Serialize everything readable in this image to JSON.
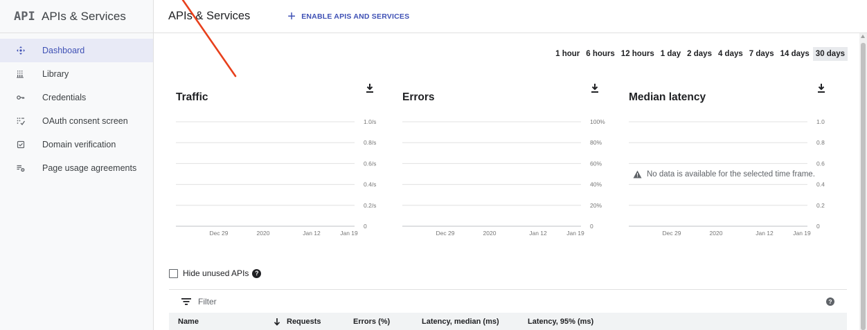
{
  "sidebar": {
    "logo": "API",
    "title": "APIs & Services",
    "items": [
      {
        "label": "Dashboard",
        "icon": "dashboard-icon",
        "active": true
      },
      {
        "label": "Library",
        "icon": "library-icon",
        "active": false
      },
      {
        "label": "Credentials",
        "icon": "key-icon",
        "active": false
      },
      {
        "label": "OAuth consent screen",
        "icon": "consent-icon",
        "active": false
      },
      {
        "label": "Domain verification",
        "icon": "checkbox-icon",
        "active": false
      },
      {
        "label": "Page usage agreements",
        "icon": "settings-list-icon",
        "active": false
      }
    ]
  },
  "header": {
    "title": "APIs & Services",
    "enable_label": "ENABLE APIS AND SERVICES"
  },
  "time_range": {
    "options": [
      "1 hour",
      "6 hours",
      "12 hours",
      "1 day",
      "2 days",
      "4 days",
      "7 days",
      "14 days",
      "30 days"
    ],
    "selected": "30 days"
  },
  "chart_data": [
    {
      "type": "line",
      "title": "Traffic",
      "x_ticks": [
        "Dec 29",
        "2020",
        "Jan 12",
        "Jan 19"
      ],
      "y_ticks": [
        "1.0/s",
        "0.8/s",
        "0.6/s",
        "0.4/s",
        "0.2/s",
        "0"
      ],
      "series": []
    },
    {
      "type": "line",
      "title": "Errors",
      "x_ticks": [
        "Dec 29",
        "2020",
        "Jan 12",
        "Jan 19"
      ],
      "y_ticks": [
        "100%",
        "80%",
        "60%",
        "40%",
        "20%",
        "0"
      ],
      "series": []
    },
    {
      "type": "line",
      "title": "Median latency",
      "x_ticks": [
        "Dec 29",
        "2020",
        "Jan 12",
        "Jan 19"
      ],
      "y_ticks": [
        "1.0",
        "0.8",
        "0.6",
        "0.4",
        "0.2",
        "0"
      ],
      "series": [],
      "no_data_message": "No data is available for the selected time frame."
    }
  ],
  "hide_unused": {
    "label": "Hide unused APIs",
    "checked": false
  },
  "filter": {
    "placeholder": "Filter"
  },
  "table": {
    "columns": [
      "Name",
      "Requests",
      "Errors (%)",
      "Latency, median (ms)",
      "Latency, 95% (ms)"
    ],
    "sort_column": "Requests"
  },
  "colors": {
    "accent": "#3f51b5",
    "annotation": "#e8401c"
  }
}
